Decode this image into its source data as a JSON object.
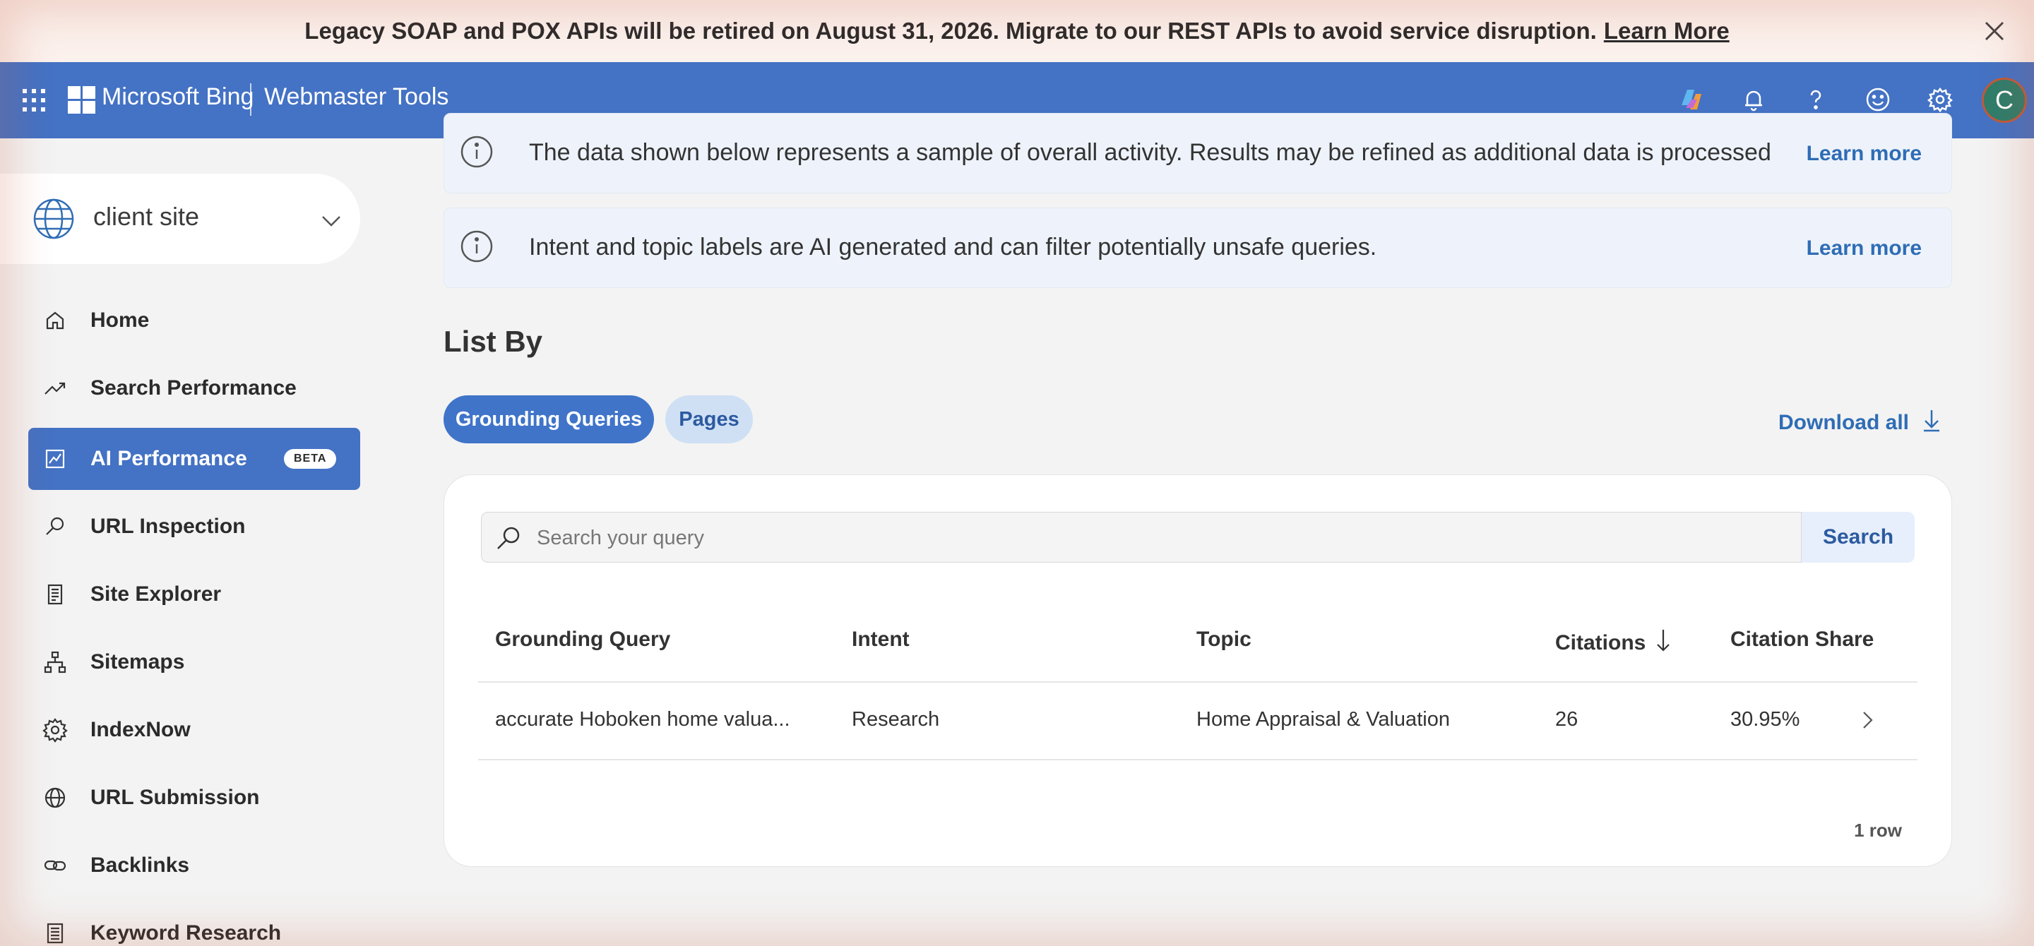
{
  "banner": {
    "message": "Legacy SOAP and POX APIs will be retired on August 31, 2026. Migrate to our REST APIs to avoid service disruption.",
    "link": "Learn More"
  },
  "topnav": {
    "brand": "Microsoft Bing",
    "product": "Webmaster Tools",
    "avatar_initial": "C",
    "icons": [
      "copilot-icon",
      "bell-icon",
      "help-icon",
      "feedback-smiley-icon",
      "gear-icon"
    ],
    "accent": "#4472c4"
  },
  "sidebar": {
    "site": "client site",
    "items": [
      {
        "label": "Home",
        "icon": "home-icon"
      },
      {
        "label": "Search Performance",
        "icon": "trend-icon"
      },
      {
        "label": "AI Performance",
        "icon": "chart-icon",
        "badge": "BETA",
        "active": true
      },
      {
        "label": "URL Inspection",
        "icon": "magnifier-icon"
      },
      {
        "label": "Site Explorer",
        "icon": "document-icon"
      },
      {
        "label": "Sitemaps",
        "icon": "sitemap-icon"
      },
      {
        "label": "IndexNow",
        "icon": "gear-icon"
      },
      {
        "label": "URL Submission",
        "icon": "globe-icon"
      },
      {
        "label": "Backlinks",
        "icon": "link-icon"
      },
      {
        "label": "Keyword Research",
        "icon": "list-icon"
      }
    ]
  },
  "notices": [
    {
      "text": "The data shown below represents a sample of overall activity. Results may be refined as additional data is processed",
      "link": "Learn more"
    },
    {
      "text": "Intent and topic labels are AI generated and can filter potentially unsafe queries.",
      "link": "Learn more"
    }
  ],
  "list_by": {
    "title": "List By",
    "tabs": [
      "Grounding Queries",
      "Pages"
    ],
    "active_tab": "Grounding Queries",
    "download": "Download all"
  },
  "search": {
    "placeholder": "Search your query",
    "button": "Search"
  },
  "table": {
    "columns": [
      "Grounding Query",
      "Intent",
      "Topic",
      "Citations",
      "Citation Share"
    ],
    "sort_column": "Citations",
    "sort_direction": "descending",
    "rows": [
      {
        "query": "accurate Hoboken home valua...",
        "intent": "Research",
        "topic": "Home Appraisal & Valuation",
        "citations": "26",
        "share": "30.95%"
      }
    ],
    "row_count": "1 row"
  }
}
